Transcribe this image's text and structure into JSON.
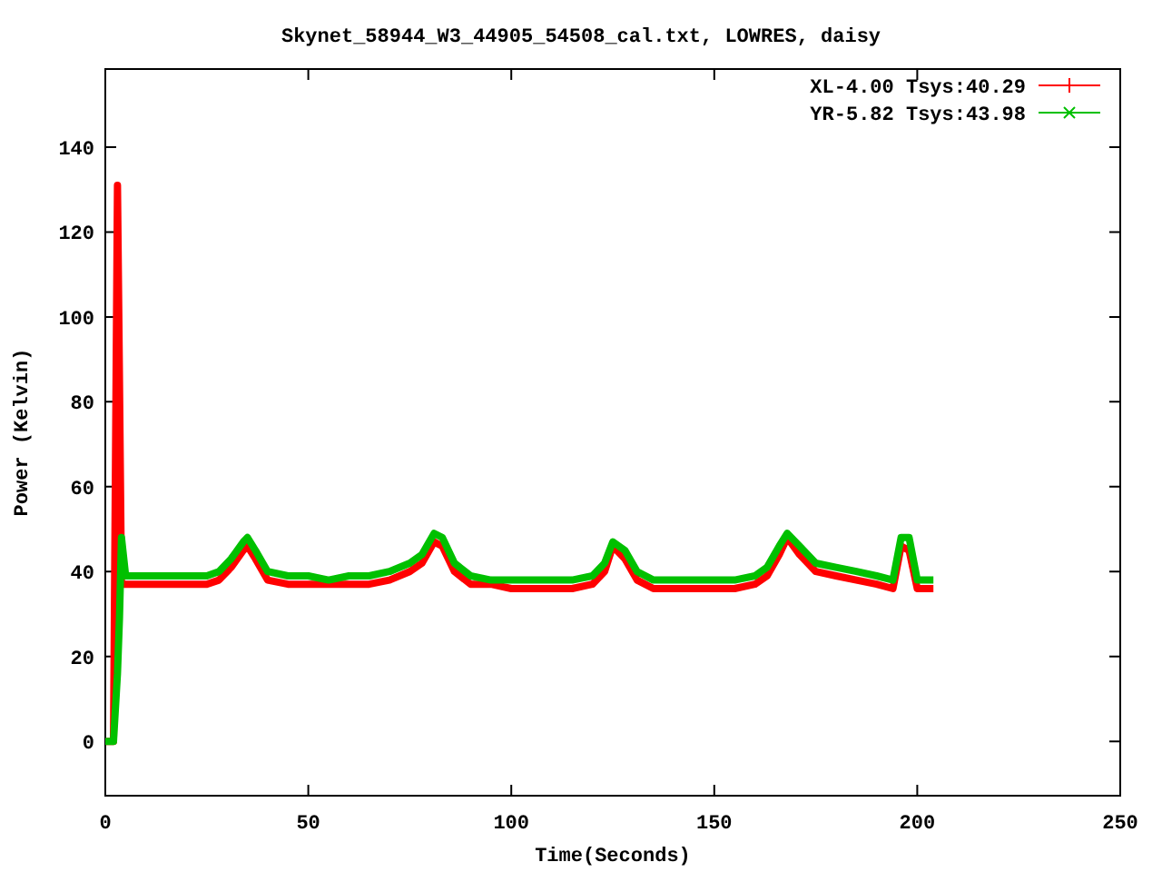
{
  "chart": {
    "chart_data": {
      "type": "line",
      "title": "Skynet_58944_W3_44905_54508_cal.txt, LOWRES, daisy",
      "xlabel": "Time(Seconds)",
      "ylabel": "Power (Kelvin)",
      "x": [
        0,
        1,
        2,
        3,
        3.5,
        4,
        5,
        10,
        15,
        20,
        25,
        28,
        31,
        34,
        35,
        37,
        40,
        45,
        50,
        55,
        60,
        65,
        70,
        75,
        78,
        81,
        83,
        86,
        90,
        95,
        100,
        105,
        110,
        115,
        120,
        123,
        125,
        128,
        131,
        135,
        140,
        145,
        150,
        155,
        160,
        163,
        166,
        168,
        171,
        175,
        180,
        185,
        190,
        194,
        196,
        198,
        200,
        202,
        204
      ],
      "series": [
        {
          "name": "XL-4.00 Tsys:40.29",
          "color": "#ff0000",
          "values": [
            0,
            0,
            0,
            131,
            85,
            37,
            37,
            37,
            37,
            37,
            37,
            38,
            41,
            45,
            46,
            43,
            38,
            37,
            37,
            37,
            37,
            37,
            38,
            40,
            42,
            47,
            46,
            40,
            37,
            37,
            36,
            36,
            36,
            36,
            37,
            40,
            46,
            43,
            38,
            36,
            36,
            36,
            36,
            36,
            37,
            39,
            44,
            48,
            44,
            40,
            39,
            38,
            37,
            36,
            46,
            45,
            36,
            36,
            36
          ]
        },
        {
          "name": "YR-5.82 Tsys:43.98",
          "color": "#00c000",
          "values": [
            0,
            0,
            0,
            16,
            29,
            48,
            39,
            39,
            39,
            39,
            39,
            40,
            43,
            47,
            48,
            45,
            40,
            39,
            39,
            38,
            39,
            39,
            40,
            42,
            44,
            49,
            48,
            42,
            39,
            38,
            38,
            38,
            38,
            38,
            39,
            42,
            47,
            45,
            40,
            38,
            38,
            38,
            38,
            38,
            39,
            41,
            46,
            49,
            46,
            42,
            41,
            40,
            39,
            38,
            48,
            48,
            38,
            38,
            38
          ]
        }
      ],
      "legend": true,
      "xlim": [
        0,
        250
      ],
      "ylim": [
        -12.8,
        158.4
      ],
      "xticks": [
        0,
        50,
        100,
        150,
        200,
        250
      ],
      "yticks": [
        0,
        20,
        40,
        60,
        80,
        100,
        120,
        140
      ]
    }
  }
}
